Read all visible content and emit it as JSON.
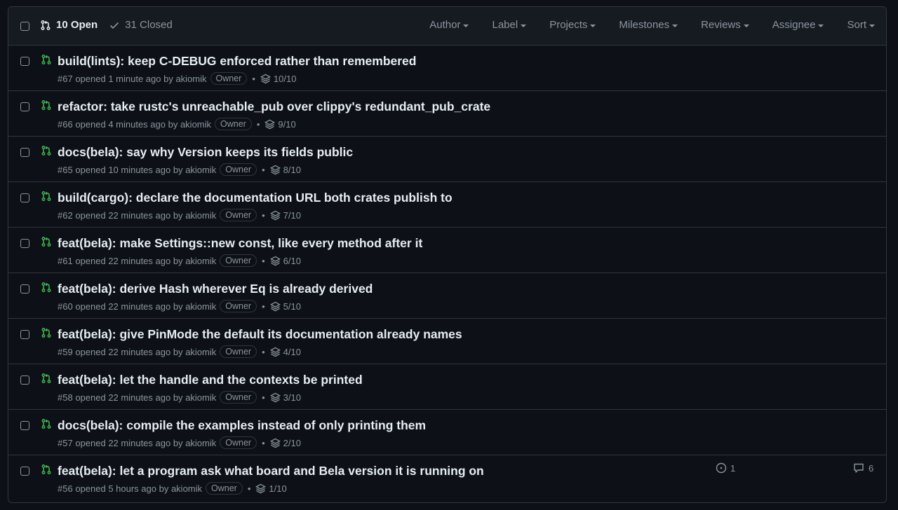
{
  "header": {
    "open_label": "10 Open",
    "closed_label": "31 Closed",
    "filters": [
      "Author",
      "Label",
      "Projects",
      "Milestones",
      "Reviews",
      "Assignee",
      "Sort"
    ]
  },
  "colors": {
    "pr_open": "#3fb950",
    "text": "#e6edf3",
    "muted": "#8b949e",
    "border": "#30363d"
  },
  "prs": [
    {
      "title": "build(lints): keep C-DEBUG enforced rather than remembered",
      "number": "#67",
      "opened": "opened 1 minute ago by",
      "author": "akiomik",
      "badge": "Owner",
      "tasks": "10/10"
    },
    {
      "title": "refactor: take rustc's unreachable_pub over clippy's redundant_pub_crate",
      "number": "#66",
      "opened": "opened 4 minutes ago by",
      "author": "akiomik",
      "badge": "Owner",
      "tasks": "9/10"
    },
    {
      "title": "docs(bela): say why Version keeps its fields public",
      "number": "#65",
      "opened": "opened 10 minutes ago by",
      "author": "akiomik",
      "badge": "Owner",
      "tasks": "8/10"
    },
    {
      "title": "build(cargo): declare the documentation URL both crates publish to",
      "number": "#62",
      "opened": "opened 22 minutes ago by",
      "author": "akiomik",
      "badge": "Owner",
      "tasks": "7/10"
    },
    {
      "title": "feat(bela): make Settings::new const, like every method after it",
      "number": "#61",
      "opened": "opened 22 minutes ago by",
      "author": "akiomik",
      "badge": "Owner",
      "tasks": "6/10"
    },
    {
      "title": "feat(bela): derive Hash wherever Eq is already derived",
      "number": "#60",
      "opened": "opened 22 minutes ago by",
      "author": "akiomik",
      "badge": "Owner",
      "tasks": "5/10"
    },
    {
      "title": "feat(bela): give PinMode the default its documentation already names",
      "number": "#59",
      "opened": "opened 22 minutes ago by",
      "author": "akiomik",
      "badge": "Owner",
      "tasks": "4/10"
    },
    {
      "title": "feat(bela): let the handle and the contexts be printed",
      "number": "#58",
      "opened": "opened 22 minutes ago by",
      "author": "akiomik",
      "badge": "Owner",
      "tasks": "3/10"
    },
    {
      "title": "docs(bela): compile the examples instead of only printing them",
      "number": "#57",
      "opened": "opened 22 minutes ago by",
      "author": "akiomik",
      "badge": "Owner",
      "tasks": "2/10"
    },
    {
      "title": "feat(bela): let a program ask what board and Bela version it is running on",
      "number": "#56",
      "opened": "opened 5 hours ago by",
      "author": "akiomik",
      "badge": "Owner",
      "tasks": "1/10",
      "linked_issues": "1",
      "comments": "6"
    }
  ]
}
